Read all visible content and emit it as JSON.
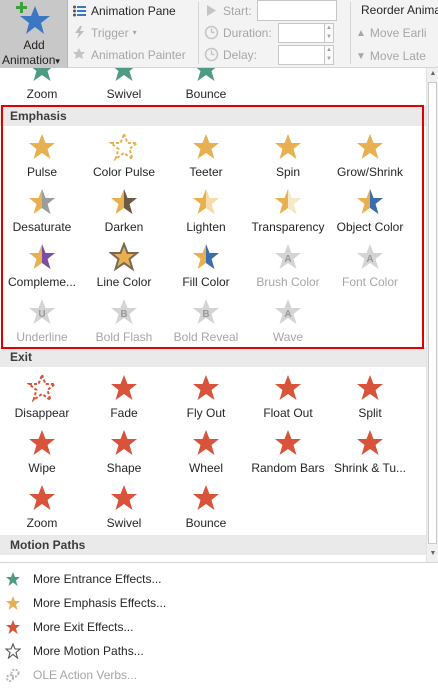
{
  "ribbon": {
    "add_animation": {
      "line1": "Add",
      "line2": "Animation",
      "dropdown": "▾"
    },
    "animation_pane": "Animation Pane",
    "trigger": "Trigger",
    "animation_painter": "Animation Painter",
    "start_label": "Start:",
    "duration_label": "Duration:",
    "delay_label": "Delay:",
    "reorder_label": "Reorder Animat",
    "move_earlier": "Move Earli",
    "move_later": "Move Late"
  },
  "gallery": {
    "top_row": [
      {
        "label": "Zoom",
        "color": "#4f9a84"
      },
      {
        "label": "Swivel",
        "color": "#4f9a84"
      },
      {
        "label": "Bounce",
        "color": "#4f9a84"
      }
    ],
    "emphasis": {
      "title": "Emphasis",
      "items": [
        {
          "label": "Pulse",
          "icon": "pulse-icon",
          "disabled": false
        },
        {
          "label": "Color Pulse",
          "icon": "color-pulse-icon",
          "disabled": false
        },
        {
          "label": "Teeter",
          "icon": "teeter-icon",
          "disabled": false
        },
        {
          "label": "Spin",
          "icon": "spin-icon",
          "disabled": false
        },
        {
          "label": "Grow/Shrink",
          "icon": "grow-shrink-icon",
          "disabled": false
        },
        {
          "label": "Desaturate",
          "icon": "desaturate-icon",
          "disabled": false
        },
        {
          "label": "Darken",
          "icon": "darken-icon",
          "disabled": false
        },
        {
          "label": "Lighten",
          "icon": "lighten-icon",
          "disabled": false
        },
        {
          "label": "Transparency",
          "icon": "transparency-icon",
          "disabled": false
        },
        {
          "label": "Object Color",
          "icon": "object-color-icon",
          "disabled": false
        },
        {
          "label": "Compleme...",
          "icon": "complementary-color-icon",
          "disabled": false
        },
        {
          "label": "Line Color",
          "icon": "line-color-icon",
          "disabled": false
        },
        {
          "label": "Fill Color",
          "icon": "fill-color-icon",
          "disabled": false
        },
        {
          "label": "Brush Color",
          "icon": "brush-color-icon",
          "disabled": true
        },
        {
          "label": "Font Color",
          "icon": "font-color-icon",
          "disabled": true
        },
        {
          "label": "Underline",
          "icon": "underline-icon",
          "disabled": true
        },
        {
          "label": "Bold Flash",
          "icon": "bold-flash-icon",
          "disabled": true
        },
        {
          "label": "Bold Reveal",
          "icon": "bold-reveal-icon",
          "disabled": true
        },
        {
          "label": "Wave",
          "icon": "wave-icon",
          "disabled": true
        }
      ]
    },
    "exit": {
      "title": "Exit",
      "items": [
        {
          "label": "Disappear",
          "icon": "disappear-icon"
        },
        {
          "label": "Fade",
          "icon": "fade-icon"
        },
        {
          "label": "Fly Out",
          "icon": "fly-out-icon"
        },
        {
          "label": "Float Out",
          "icon": "float-out-icon"
        },
        {
          "label": "Split",
          "icon": "split-icon"
        },
        {
          "label": "Wipe",
          "icon": "wipe-icon"
        },
        {
          "label": "Shape",
          "icon": "shape-icon"
        },
        {
          "label": "Wheel",
          "icon": "wheel-icon"
        },
        {
          "label": "Random Bars",
          "icon": "random-bars-icon"
        },
        {
          "label": "Shrink & Tu...",
          "icon": "shrink-turn-icon"
        },
        {
          "label": "Zoom",
          "icon": "zoom-icon"
        },
        {
          "label": "Swivel",
          "icon": "swivel-icon"
        },
        {
          "label": "Bounce",
          "icon": "bounce-icon"
        }
      ]
    },
    "motion_paths": {
      "title": "Motion Paths"
    }
  },
  "menu": [
    {
      "label": "More Entrance Effects...",
      "icon": "entrance-star-icon",
      "color": "#4f9a84",
      "disabled": false
    },
    {
      "label": "More Emphasis Effects...",
      "icon": "emphasis-star-icon",
      "color": "#e8b050",
      "disabled": false
    },
    {
      "label": "More Exit Effects...",
      "icon": "exit-star-icon",
      "color": "#d9533a",
      "disabled": false
    },
    {
      "label": "More Motion Paths...",
      "icon": "motion-path-star-icon",
      "color": "#555555",
      "disabled": false
    },
    {
      "label": "OLE Action Verbs...",
      "icon": "ole-action-icon",
      "color": "#b0b0b0",
      "disabled": true
    }
  ],
  "colors": {
    "entrance": "#4f9a84",
    "emphasis": "#e8b050",
    "exit": "#d9533a",
    "highlight_border": "#e00000",
    "disabled": "#a6a6a6"
  }
}
